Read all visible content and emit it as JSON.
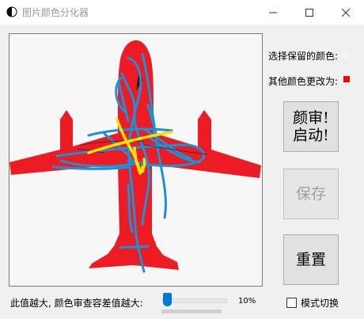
{
  "window": {
    "title": "图片颜色分化器",
    "icon": "half-circle-icon",
    "controls": [
      "minimize-icon",
      "maximize-icon",
      "close-icon"
    ]
  },
  "panel": {
    "keep_color_label": "选择保留的颜色:",
    "keep_color_value": "#f4f4f4",
    "other_color_label": "其他颜色更改为:",
    "other_color_value": "#ff0000"
  },
  "buttons": {
    "start_line1": "颜审!",
    "start_line2": "启动!",
    "save": "保存",
    "reset": "重置"
  },
  "tolerance": {
    "label": "此值越大, 颜色审查容差值越大:",
    "value_text": "10%",
    "value": 0.1
  },
  "mode": {
    "label": "模式切换",
    "checked": false
  },
  "image": {
    "subject": "red airplane with blue and yellow scribbles",
    "colors": {
      "plane": "#ed1c24",
      "scribble_blue": "#1e90d6",
      "scribble_yellow": "#ffe000"
    }
  }
}
